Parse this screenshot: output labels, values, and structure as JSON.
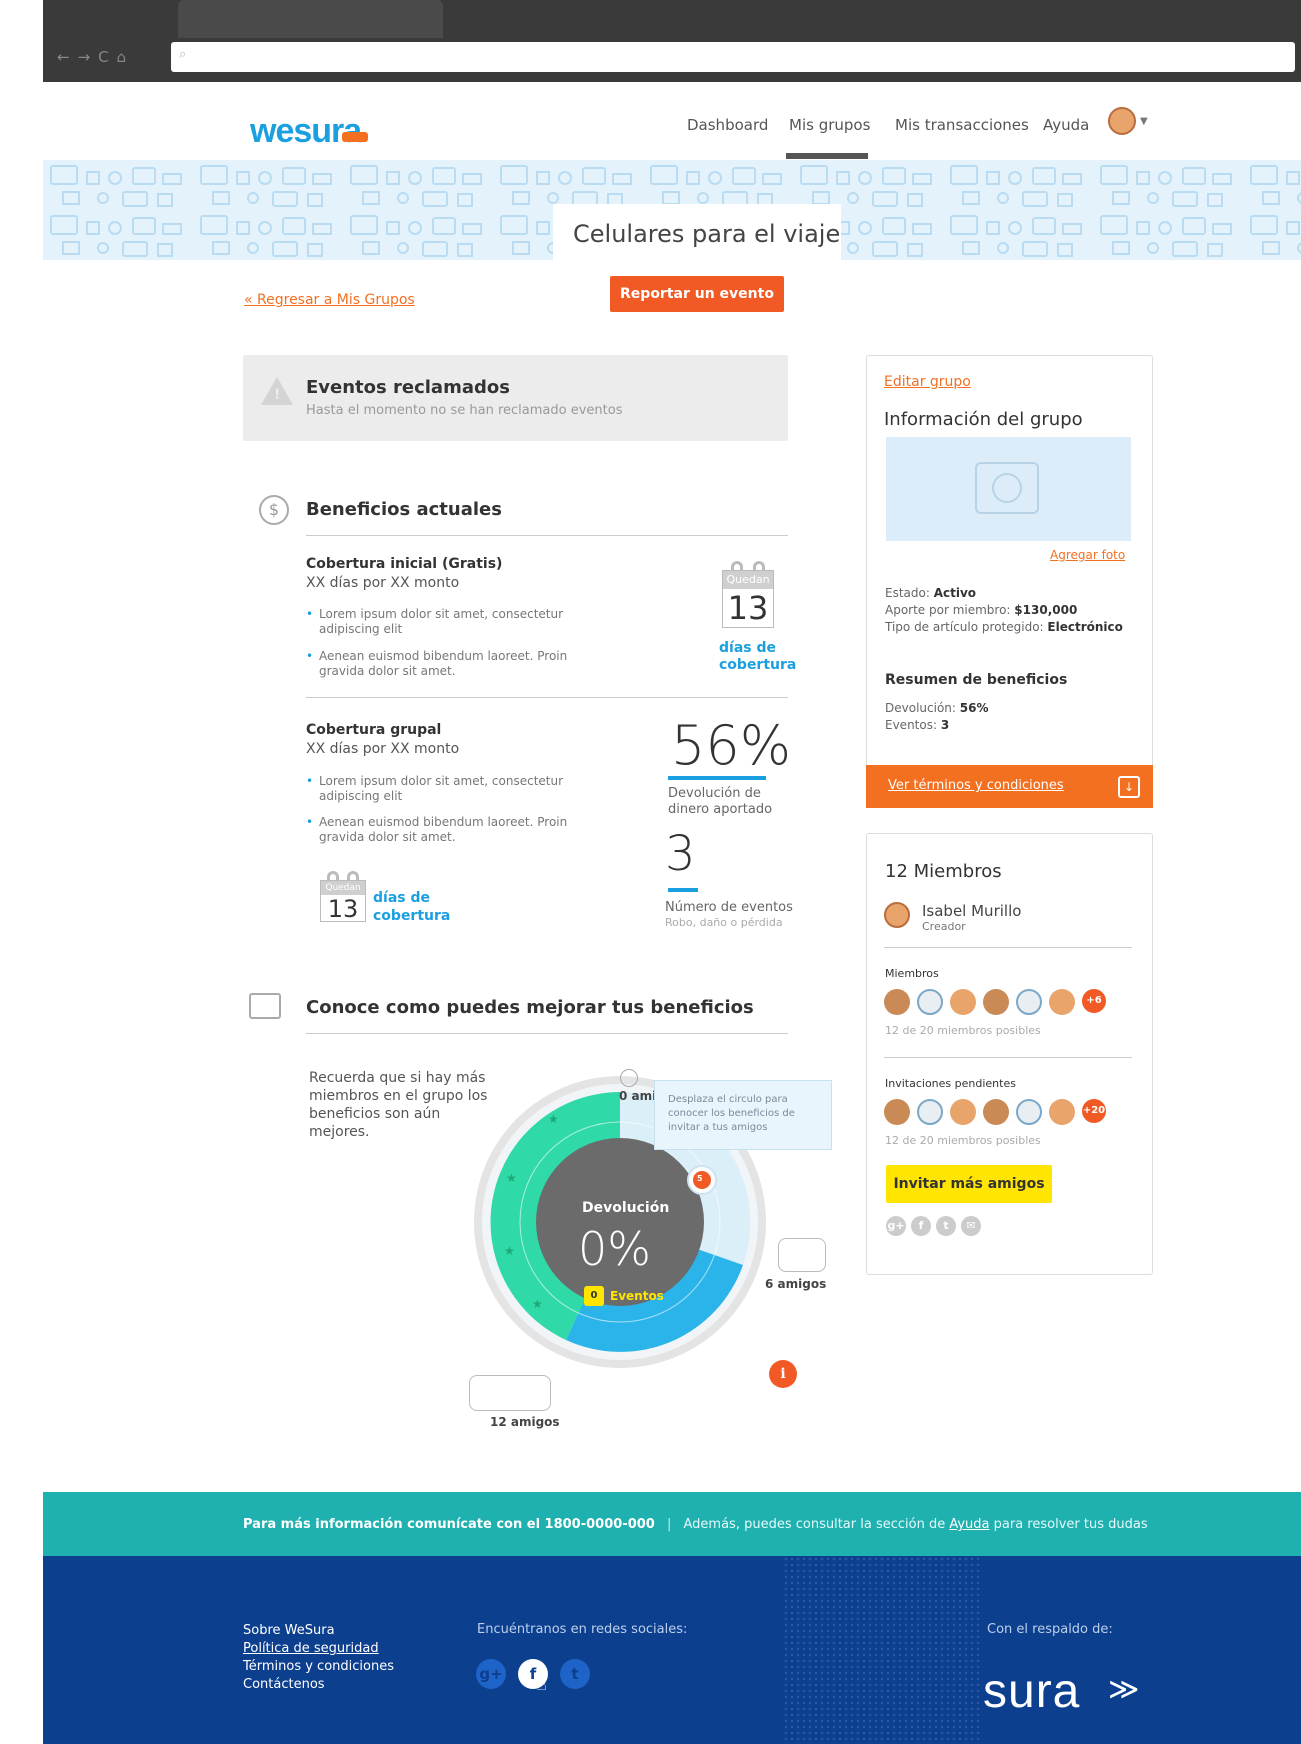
{
  "nav": {
    "logo": "wesura",
    "items": [
      "Dashboard",
      "Mis grupos",
      "Mis transacciones",
      "Ayuda"
    ],
    "active": "Mis grupos"
  },
  "hero": {
    "title": "Celulares para el viaje"
  },
  "actions": {
    "back_link": "« Regresar a Mis Grupos",
    "report_button": "Reportar un evento"
  },
  "claimed": {
    "title": "Eventos reclamados",
    "subtitle": "Hasta el momento no se han reclamado eventos"
  },
  "benefits": {
    "title": "Beneficios actuales",
    "initial": {
      "title": "Cobertura inicial (Gratis)",
      "subtitle": "XX días por XX monto",
      "bullets": [
        "Lorem ipsum dolor sit amet, consectetur adipiscing elit",
        "Aenean euismod bibendum laoreet. Proin gravida dolor sit amet."
      ],
      "calendar_top": "Quedan",
      "calendar_num": "13",
      "calendar_label_1": "días de",
      "calendar_label_2": "cobertura"
    },
    "group": {
      "title": "Cobertura grupal",
      "subtitle": "XX días por XX monto",
      "bullets": [
        "Lorem ipsum dolor sit amet, consectetur adipiscing elit",
        "Aenean euismod bibendum laoreet. Proin gravida dolor sit amet."
      ],
      "calendar_top": "Quedan",
      "calendar_num": "13",
      "calendar_label_1": "días de",
      "calendar_label_2": "cobertura",
      "refund_value": "56%",
      "refund_label_1": "Devolución de",
      "refund_label_2": "dinero aportado",
      "events_value": "3",
      "events_label": "Número de eventos",
      "events_sub": "Robo, daño o pérdida"
    }
  },
  "improve": {
    "title": "Conoce como puedes mejorar tus beneficios",
    "text_lines": [
      "Recuerda que si hay más",
      "miembros en el grupo los",
      "beneficios son aún",
      "mejores."
    ],
    "tooltip_lines": [
      "Desplaza el circulo para",
      "conocer los beneficios de",
      "invitar a tus amigos"
    ],
    "label_0": "0 ami",
    "label_6": "6 amigos",
    "label_12": "12 amigos",
    "handle_num": "5",
    "dial_title": "Devolución",
    "dial_value": "0%",
    "dial_events_num": "0",
    "dial_events_label": "Eventos",
    "info": "i"
  },
  "group_info": {
    "edit_link": "Editar grupo",
    "title": "Información del grupo",
    "add_photo": "Agregar foto",
    "estado_label": "Estado: ",
    "estado_value": "Activo",
    "aporte_label": "Aporte por miembro: ",
    "aporte_value": "$130,000",
    "tipo_label": "Tipo de artículo protegido: ",
    "tipo_value": "Electrónico",
    "summary_title": "Resumen de beneficios",
    "dev_label": "Devolución: ",
    "dev_value": "56%",
    "ev_label": "Eventos: ",
    "ev_value": "3",
    "terms_link": "Ver términos y condiciones"
  },
  "members": {
    "title": "12 Miembros",
    "creator_name": "Isabel Murillo",
    "creator_role": "Creador",
    "members_label": "Miembros",
    "members_more": "+6",
    "members_caption": "12 de 20 miembros posibles",
    "pending_label": "Invitaciones pendientes",
    "pending_more": "+20",
    "pending_caption": "12 de 20 miembros posibles",
    "invite_button": "Invitar más amigos",
    "socials": [
      "g+",
      "f",
      "t",
      "✉"
    ]
  },
  "strip": {
    "bold": "Para más información comunícate con el 1800-0000-000",
    "rest_1": "Además, puedes consultar la sección de ",
    "link": "Ayuda",
    "rest_2": " para resolver tus dudas"
  },
  "footer": {
    "links": [
      "Sobre WeSura",
      "Política de seguridad",
      "Términos y condiciones",
      "Contáctenos"
    ],
    "social_title": "Encuéntranos en redes sociales:",
    "socials": [
      "g+",
      "f",
      "t"
    ],
    "backing": "Con el respaldo de:",
    "brand": "sura"
  },
  "colors": {
    "orange": "#f37021",
    "blue": "#1a9fe0",
    "teal": "#1fb0b0",
    "navy": "#0d3f8f",
    "yellow": "#ffe500",
    "green": "#2fd9a8"
  }
}
